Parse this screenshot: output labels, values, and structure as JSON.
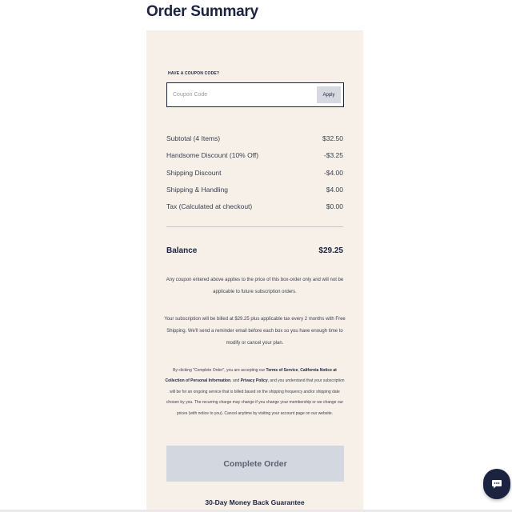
{
  "header": {
    "title": "Order Summary"
  },
  "coupon": {
    "heading": "HAVE A COUPON CODE?",
    "placeholder": "Coupon Code",
    "apply_label": "Apply"
  },
  "summary": {
    "line_items": [
      {
        "label": "Subtotal (4 Items)",
        "value": "$32.50"
      },
      {
        "label": "Handsome Discount (10% Off)",
        "value": "-$3.25"
      },
      {
        "label": "Shipping Discount",
        "value": "-$4.00"
      },
      {
        "label": "Shipping & Handling",
        "value": "$4.00"
      },
      {
        "label": "Tax (Calculated at checkout)",
        "value": "$0.00"
      }
    ],
    "balance_label": "Balance",
    "balance_value": "$29.25"
  },
  "notes": {
    "coupon_note": "Any coupon entered above applies to the price of this box-order only and will not be applicable to future subscription orders.",
    "billing_note": "Your subscription will be billed at $29.25 plus applicable tax every 2 months with Free Shipping. We'll send a reminder email before each box so you have enough time to modify or cancel your plan."
  },
  "legal": {
    "part1": "By clicking \"Complete Order\", you are accepting our ",
    "terms_link": "Terms of Service",
    "part2": ", ",
    "california_link": "California Notice at Collection of Personal Information",
    "part3": ", and ",
    "privacy_link": "Privacy Policy",
    "part4": ", and you understand that your subscription will be for an ongoing service that is billed based on the shipping frequency and/or shipping date chosen by you. The recurring charge may change if you change your membership or we change our prices (with notice to you). Cancel anytime by visiting your account page on our website."
  },
  "actions": {
    "complete_order_label": "Complete Order"
  },
  "footer": {
    "guarantee": "30-Day Money Back Guarantee"
  },
  "chat": {
    "icon": "chat-bubble-icon"
  },
  "colors": {
    "navy": "#1c2340",
    "panel_background": "#f6f0e8",
    "disabled_button": "#d3d7df"
  }
}
